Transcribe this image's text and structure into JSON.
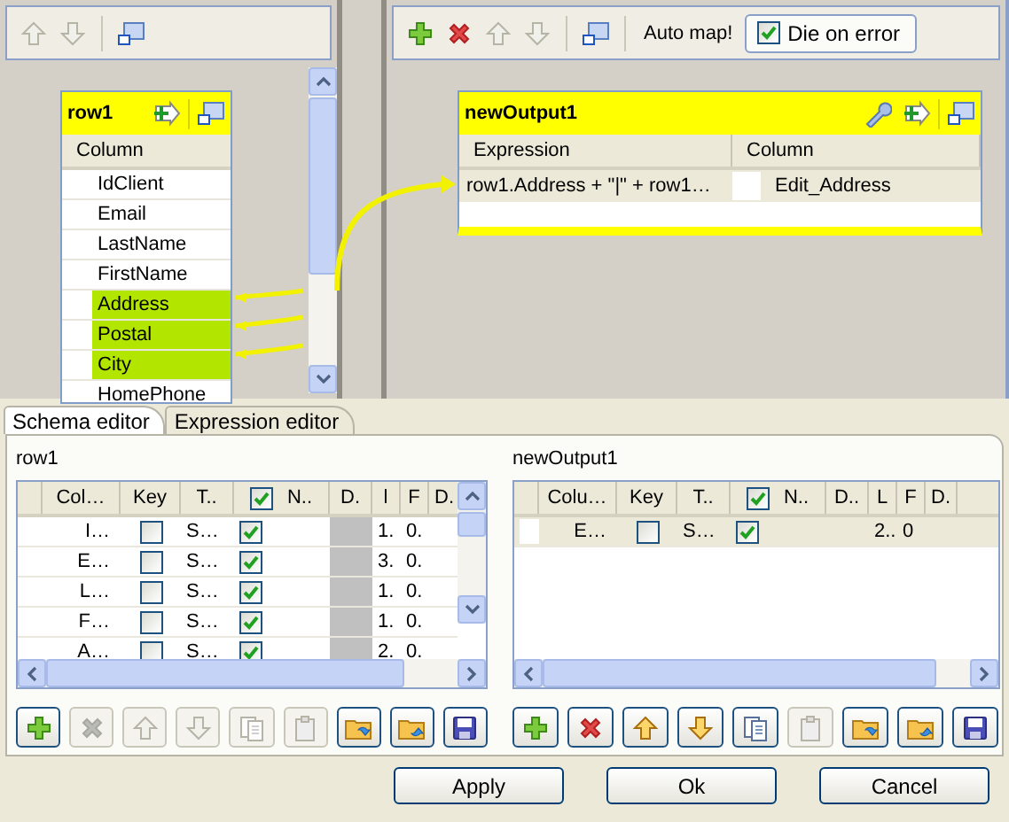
{
  "input_toolbar": [
    {
      "kind": "up",
      "disabled": true
    },
    {
      "kind": "down",
      "disabled": true
    },
    {
      "kind": "window",
      "disabled": false
    }
  ],
  "output_toolbar": {
    "buttons": [
      {
        "kind": "add",
        "disabled": false
      },
      {
        "kind": "remove",
        "disabled": false
      },
      {
        "kind": "up",
        "disabled": true
      },
      {
        "kind": "down",
        "disabled": true
      },
      {
        "kind": "window",
        "disabled": false
      }
    ],
    "auto_map": "Auto map!",
    "die_on_error": {
      "label": "Die on error",
      "checked": true
    }
  },
  "input_table": {
    "title": "row1",
    "header": "Column",
    "rows": [
      {
        "name": "IdClient",
        "selected": false
      },
      {
        "name": "Email",
        "selected": false
      },
      {
        "name": "LastName",
        "selected": false
      },
      {
        "name": "FirstName",
        "selected": false
      },
      {
        "name": "Address",
        "selected": true
      },
      {
        "name": "Postal",
        "selected": true
      },
      {
        "name": "City",
        "selected": true
      },
      {
        "name": "HomePhone",
        "selected": false
      }
    ]
  },
  "output_table": {
    "title": "newOutput1",
    "headers": [
      "Expression",
      "Column"
    ],
    "rows": [
      {
        "expression": "row1.Address + \"|\" + row1…",
        "column": "Edit_Address"
      }
    ]
  },
  "tabs": [
    {
      "label": "Schema editor",
      "selected": true
    },
    {
      "label": "Expression editor",
      "selected": false
    }
  ],
  "schema_editors": [
    {
      "title": "row1",
      "columns": [
        "Col…",
        "Key",
        "T..",
        "N..",
        "D.",
        "l",
        "F",
        "D."
      ],
      "header_checked": true,
      "default_greyed": true,
      "rows": [
        {
          "column": "I…",
          "key": false,
          "type": "S…",
          "nullable": true,
          "length": "1.",
          "precision": "0.",
          "selected": false
        },
        {
          "column": "E…",
          "key": false,
          "type": "S…",
          "nullable": true,
          "length": "3.",
          "precision": "0.",
          "selected": false
        },
        {
          "column": "L…",
          "key": false,
          "type": "S…",
          "nullable": true,
          "length": "1.",
          "precision": "0.",
          "selected": false
        },
        {
          "column": "F…",
          "key": false,
          "type": "S…",
          "nullable": true,
          "length": "1.",
          "precision": "0.",
          "selected": false
        },
        {
          "column": "A…",
          "key": false,
          "type": "S…",
          "nullable": true,
          "length": "2.",
          "precision": "0.",
          "selected": false
        }
      ],
      "buttons": [
        {
          "kind": "add",
          "disabled": false
        },
        {
          "kind": "remove",
          "disabled": true
        },
        {
          "kind": "up",
          "disabled": true
        },
        {
          "kind": "down",
          "disabled": true
        },
        {
          "kind": "copy",
          "disabled": true
        },
        {
          "kind": "paste",
          "disabled": true
        },
        {
          "kind": "import",
          "disabled": false
        },
        {
          "kind": "export",
          "disabled": false
        },
        {
          "kind": "save",
          "disabled": false
        }
      ]
    },
    {
      "title": "newOutput1",
      "columns": [
        "Colu…",
        "Key",
        "T..",
        "N..",
        "D..",
        "L",
        "F",
        "D."
      ],
      "header_checked": true,
      "default_greyed": false,
      "rows": [
        {
          "column": "E…",
          "key": false,
          "type": "S…",
          "nullable": true,
          "length": "2..",
          "precision": "0",
          "selected": true
        }
      ],
      "buttons": [
        {
          "kind": "add",
          "disabled": false
        },
        {
          "kind": "remove",
          "disabled": false
        },
        {
          "kind": "up",
          "disabled": false
        },
        {
          "kind": "down",
          "disabled": false
        },
        {
          "kind": "copy",
          "disabled": false
        },
        {
          "kind": "paste",
          "disabled": true
        },
        {
          "kind": "import",
          "disabled": false
        },
        {
          "kind": "export",
          "disabled": false
        },
        {
          "kind": "save",
          "disabled": false
        }
      ]
    }
  ],
  "footer_buttons": [
    "Apply",
    "Ok",
    "Cancel"
  ]
}
